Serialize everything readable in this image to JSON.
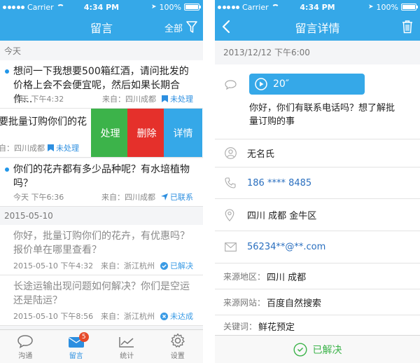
{
  "left": {
    "status": {
      "carrier": "Carrier",
      "time": "4:34 PM",
      "battery": "100%"
    },
    "nav": {
      "title": "留言",
      "filter_label": "全部"
    },
    "sections": [
      {
        "header": "今天"
      },
      {
        "header": "2015-05-10"
      }
    ],
    "messages": [
      {
        "text": "想问一下我想要500箱红酒，请问批发的价格上会不会便宜呢，然后如果长期合作...",
        "time": "今天 下午4:32",
        "from": "来自：四川成都",
        "status": "未处理"
      },
      {
        "text": "你们的花卉都有多少品种呢？有水培植物吗？",
        "time": "今天 下午6:36",
        "from": "来自：四川成都",
        "status": "已联系"
      },
      {
        "text": "你好，批量订购你们的花卉，有优惠吗？报价单在哪里查看？",
        "time": "2015-05-10 下午4:32",
        "from": "来自：浙江杭州",
        "status": "已解决"
      },
      {
        "text": "长途运输出现问题如何解决？你们是空运还是陆运？",
        "time": "2015-05-10 下午8:56",
        "from": "来自：浙江杭州",
        "status": "未达成"
      }
    ],
    "swipe": {
      "text": "要批量订购你们的花",
      "from": "自：四川成都",
      "status": "未处理",
      "actions": {
        "process": "处理",
        "delete": "删除",
        "detail": "详情"
      }
    },
    "tabs": [
      {
        "label": "沟通",
        "icon": "chat-bubble-icon"
      },
      {
        "label": "留言",
        "icon": "envelope-icon",
        "badge": "5"
      },
      {
        "label": "统计",
        "icon": "chart-line-icon"
      },
      {
        "label": "设置",
        "icon": "gear-icon"
      }
    ]
  },
  "right": {
    "status": {
      "carrier": "Carrier",
      "time": "4:34 PM",
      "battery": "100%"
    },
    "nav": {
      "title": "留言详情"
    },
    "date": "2013/12/12  下午6:00",
    "voice_duration": "20″",
    "message": "你好，你们有联系电话吗？想了解批量订购的事",
    "name": "无名氏",
    "phone": "186 **** 8485",
    "address": "四川 成都 金牛区",
    "email": "56234**@**.com",
    "source_region": {
      "key": "来源地区：",
      "value": "四川  成都"
    },
    "source_site": {
      "key": "来源网站：",
      "value": "百度自然搜索"
    },
    "keyword": {
      "key": "关键词：",
      "value": "鲜花预定"
    },
    "resolved_label": "已解决"
  },
  "colors": {
    "brand": "#35a8e8",
    "process": "#3cb34a",
    "delete": "#e5302b",
    "badge": "#e64a2b",
    "link": "#2a6fbf"
  }
}
